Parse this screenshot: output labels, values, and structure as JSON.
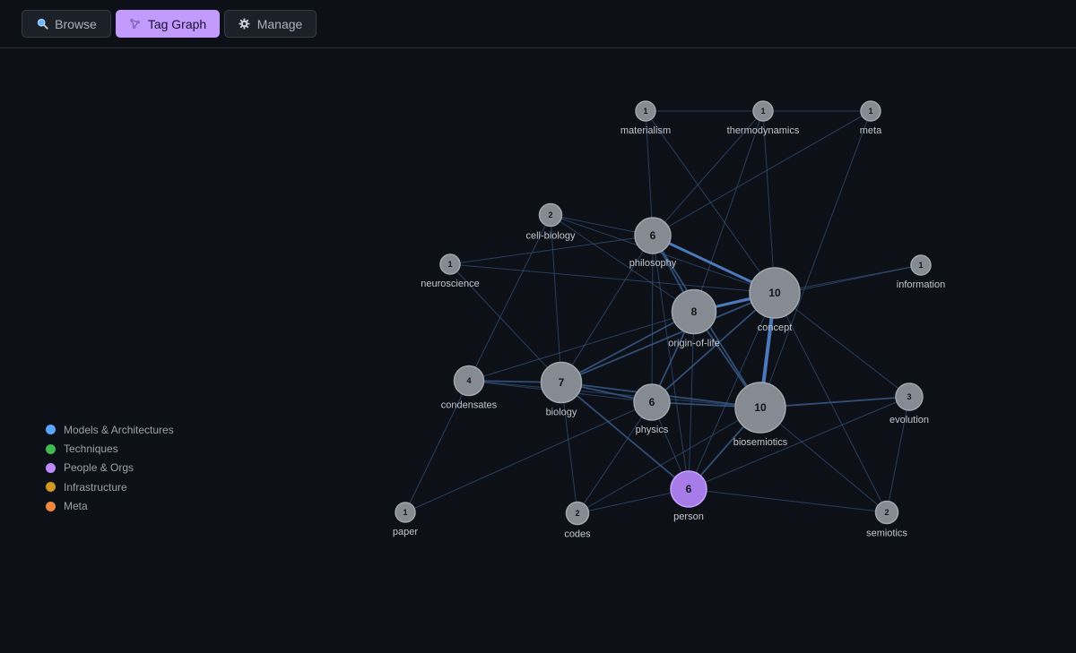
{
  "tabs": [
    {
      "id": "browse",
      "label": "Browse",
      "icon": "search-icon",
      "active": false
    },
    {
      "id": "tag-graph",
      "label": "Tag Graph",
      "icon": "graph-icon",
      "active": true
    },
    {
      "id": "manage",
      "label": "Manage",
      "icon": "gear-icon",
      "active": false
    }
  ],
  "legend": [
    {
      "label": "Models & Architectures",
      "color": "#58a6ff"
    },
    {
      "label": "Techniques",
      "color": "#3fb950"
    },
    {
      "label": "People & Orgs",
      "color": "#bc8cff"
    },
    {
      "label": "Infrastructure",
      "color": "#d29922"
    },
    {
      "label": "Meta",
      "color": "#f0883e"
    }
  ],
  "graph": {
    "nodes": [
      {
        "id": "materialism",
        "label": "materialism",
        "count": 1
      },
      {
        "id": "thermodynamics",
        "label": "thermodynamics",
        "count": 1
      },
      {
        "id": "meta",
        "label": "meta",
        "count": 1
      },
      {
        "id": "cell-biology",
        "label": "cell-biology",
        "count": 2
      },
      {
        "id": "philosophy",
        "label": "philosophy",
        "count": 6
      },
      {
        "id": "neuroscience",
        "label": "neuroscience",
        "count": 1
      },
      {
        "id": "information",
        "label": "information",
        "count": 1
      },
      {
        "id": "concept",
        "label": "concept",
        "count": 10
      },
      {
        "id": "origin-of-life",
        "label": "origin-of-life",
        "count": 8
      },
      {
        "id": "condensates",
        "label": "condensates",
        "count": 4
      },
      {
        "id": "biology",
        "label": "biology",
        "count": 7
      },
      {
        "id": "physics",
        "label": "physics",
        "count": 6
      },
      {
        "id": "biosemiotics",
        "label": "biosemiotics",
        "count": 10
      },
      {
        "id": "evolution",
        "label": "evolution",
        "count": 3
      },
      {
        "id": "person",
        "label": "person",
        "count": 6,
        "category": "People & Orgs"
      },
      {
        "id": "paper",
        "label": "paper",
        "count": 1
      },
      {
        "id": "codes",
        "label": "codes",
        "count": 2
      },
      {
        "id": "semiotics",
        "label": "semiotics",
        "count": 2
      }
    ],
    "edges": [
      [
        "materialism",
        "thermodynamics",
        1
      ],
      [
        "thermodynamics",
        "meta",
        1
      ],
      [
        "materialism",
        "philosophy",
        1
      ],
      [
        "materialism",
        "concept",
        1
      ],
      [
        "thermodynamics",
        "philosophy",
        1
      ],
      [
        "thermodynamics",
        "origin-of-life",
        1
      ],
      [
        "thermodynamics",
        "concept",
        1
      ],
      [
        "meta",
        "philosophy",
        1
      ],
      [
        "meta",
        "biosemiotics",
        1
      ],
      [
        "cell-biology",
        "philosophy",
        1
      ],
      [
        "cell-biology",
        "origin-of-life",
        1
      ],
      [
        "cell-biology",
        "condensates",
        1
      ],
      [
        "cell-biology",
        "biology",
        1
      ],
      [
        "cell-biology",
        "concept",
        1
      ],
      [
        "neuroscience",
        "philosophy",
        1
      ],
      [
        "neuroscience",
        "biology",
        1
      ],
      [
        "neuroscience",
        "concept",
        1
      ],
      [
        "philosophy",
        "origin-of-life",
        2
      ],
      [
        "philosophy",
        "concept",
        3
      ],
      [
        "philosophy",
        "biology",
        1
      ],
      [
        "philosophy",
        "physics",
        1
      ],
      [
        "philosophy",
        "biosemiotics",
        2
      ],
      [
        "philosophy",
        "person",
        1
      ],
      [
        "information",
        "concept",
        1
      ],
      [
        "information",
        "origin-of-life",
        1
      ],
      [
        "concept",
        "origin-of-life",
        3
      ],
      [
        "concept",
        "biosemiotics",
        4
      ],
      [
        "concept",
        "biology",
        2
      ],
      [
        "concept",
        "physics",
        2
      ],
      [
        "concept",
        "evolution",
        1
      ],
      [
        "concept",
        "person",
        1
      ],
      [
        "concept",
        "semiotics",
        1
      ],
      [
        "origin-of-life",
        "biology",
        2
      ],
      [
        "origin-of-life",
        "condensates",
        1
      ],
      [
        "origin-of-life",
        "physics",
        2
      ],
      [
        "origin-of-life",
        "biosemiotics",
        2
      ],
      [
        "origin-of-life",
        "person",
        1
      ],
      [
        "condensates",
        "biology",
        2
      ],
      [
        "condensates",
        "physics",
        1
      ],
      [
        "condensates",
        "biosemiotics",
        1
      ],
      [
        "condensates",
        "paper",
        1
      ],
      [
        "biology",
        "physics",
        2
      ],
      [
        "biology",
        "biosemiotics",
        2
      ],
      [
        "biology",
        "person",
        2
      ],
      [
        "biology",
        "codes",
        1
      ],
      [
        "physics",
        "biosemiotics",
        2
      ],
      [
        "physics",
        "person",
        1
      ],
      [
        "physics",
        "paper",
        1
      ],
      [
        "physics",
        "codes",
        1
      ],
      [
        "biosemiotics",
        "evolution",
        2
      ],
      [
        "biosemiotics",
        "person",
        2
      ],
      [
        "biosemiotics",
        "semiotics",
        1
      ],
      [
        "biosemiotics",
        "codes",
        1
      ],
      [
        "evolution",
        "semiotics",
        1
      ],
      [
        "evolution",
        "person",
        1
      ],
      [
        "person",
        "codes",
        1
      ],
      [
        "person",
        "semiotics",
        1
      ]
    ]
  }
}
